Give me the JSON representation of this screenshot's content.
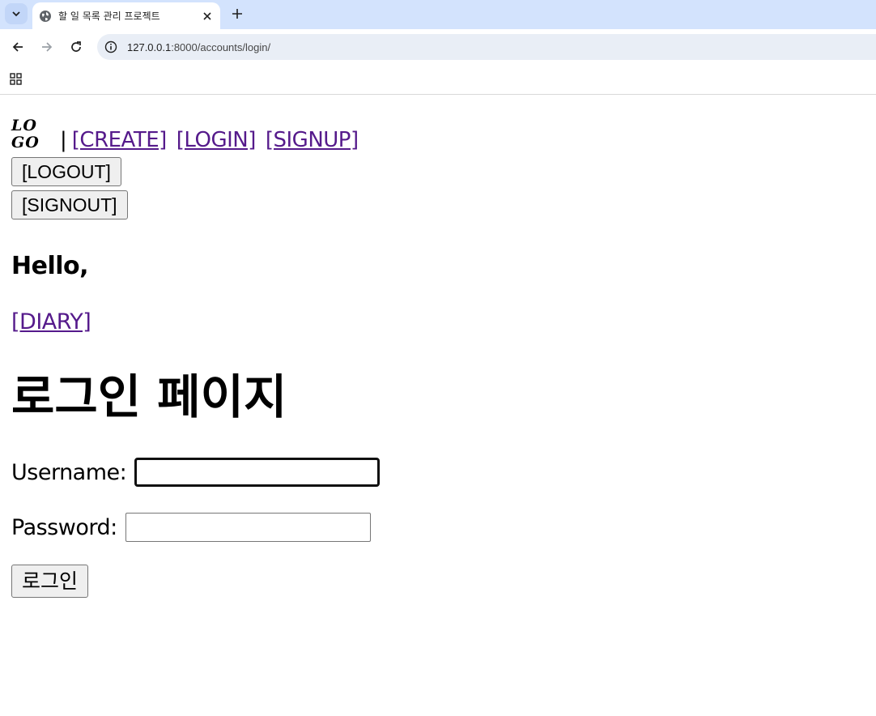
{
  "browser": {
    "tab_title": "할 일 목록 관리 프로젝트",
    "url_host": "127.0.0.1",
    "url_path": ":8000/accounts/login/"
  },
  "nav": {
    "logo_line1": "LO",
    "logo_line2": "GO",
    "separator": "|",
    "create": "[CREATE]",
    "login": "[LOGIN]",
    "signup": "[SIGNUP]",
    "logout_button": "[LOGOUT]",
    "signout_button": "[SIGNOUT]"
  },
  "greeting": "Hello,",
  "diary_link": "[DIARY]",
  "page_title": "로그인 페이지",
  "form": {
    "username_label": "Username:",
    "username_value": "",
    "password_label": "Password:",
    "password_value": "",
    "submit_label": "로그인"
  }
}
